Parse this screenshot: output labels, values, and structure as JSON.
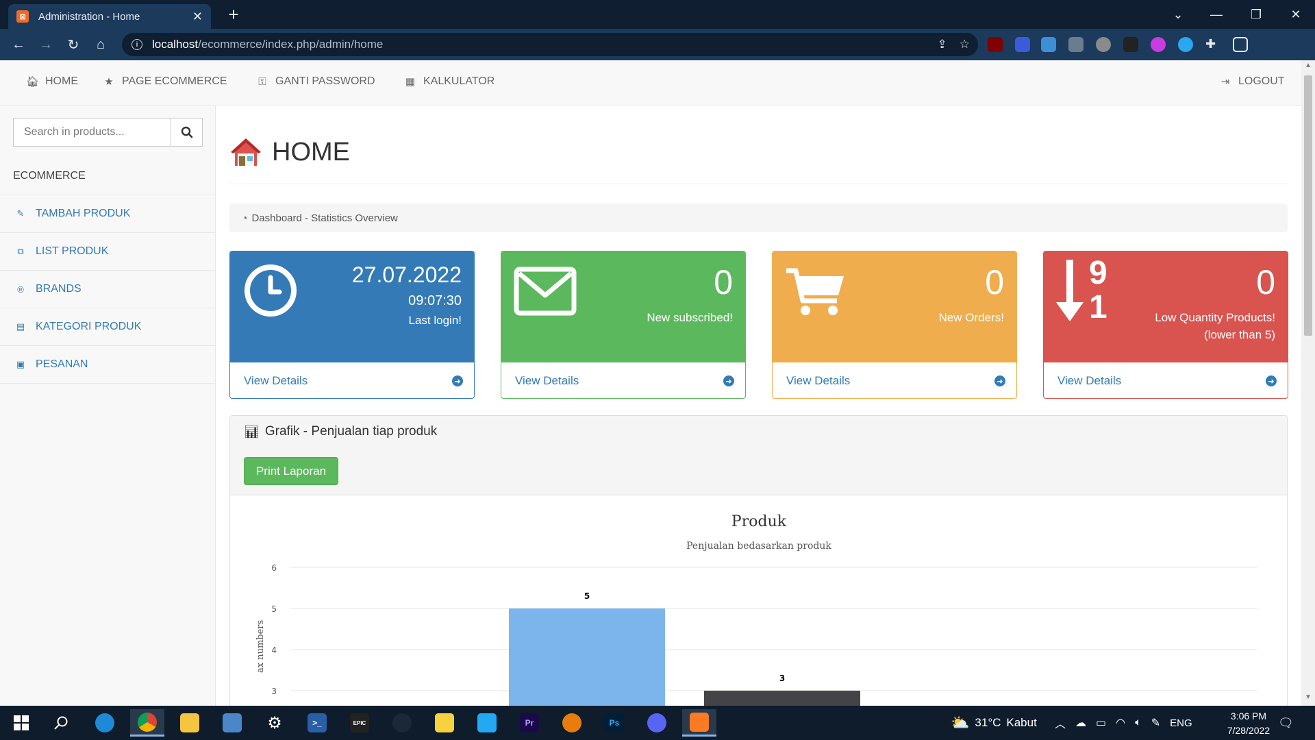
{
  "browser": {
    "tab_title": "Administration - Home",
    "tab_favicon_letter": "⊠",
    "url_host": "localhost",
    "url_path": "/ecommerce/index.php/admin/home"
  },
  "topnav": {
    "home": "HOME",
    "page_ecommerce": "PAGE ECOMMERCE",
    "ganti_password": "GANTI PASSWORD",
    "kalkulator": "KALKULATOR",
    "logout": "LOGOUT"
  },
  "sidebar": {
    "search_placeholder": "Search in products...",
    "heading": "ECOMMERCE",
    "items": [
      {
        "label": "TAMBAH PRODUK",
        "icon": "edit-icon"
      },
      {
        "label": "LIST PRODUK",
        "icon": "copy-icon"
      },
      {
        "label": "BRANDS",
        "icon": "registered-icon"
      },
      {
        "label": "KATEGORI PRODUK",
        "icon": "list-alt-icon"
      },
      {
        "label": "PESANAN",
        "icon": "money-icon"
      }
    ]
  },
  "main": {
    "title": "HOME",
    "breadcrumb": "Dashboard - Statistics Overview",
    "panels": [
      {
        "name": "last-login",
        "big": "27.07.2022",
        "sub1": "09:07:30",
        "sub2": "Last login!",
        "link": "View Details",
        "color": "#337ab7",
        "icon": "clock-icon"
      },
      {
        "name": "subscribed",
        "big": "0",
        "sub1": "New subscribed!",
        "link": "View Details",
        "color": "#5cb85c",
        "icon": "envelope-icon"
      },
      {
        "name": "orders",
        "big": "0",
        "sub1": "New Orders!",
        "link": "View Details",
        "color": "#f0ad4e",
        "icon": "cart-icon"
      },
      {
        "name": "low-quantity",
        "big": "0",
        "sub1": "Low Quantity Products!",
        "sub2": "(lower than 5)",
        "link": "View Details",
        "color": "#d9534f",
        "icon": "sort-numeric-desc-icon",
        "icon_digits": [
          "9",
          "1"
        ]
      }
    ],
    "chart_panel_title": "Grafik - Penjualan tiap produk",
    "print_button": "Print Laporan"
  },
  "chart_data": {
    "type": "bar",
    "title": "Produk",
    "subtitle": "Penjualan bedasarkan produk",
    "ylabel": "ax numbers",
    "ylim": [
      0,
      6
    ],
    "yticks": [
      "3",
      "4",
      "5",
      "6"
    ],
    "visible_bars": [
      {
        "value": 5,
        "label": "5",
        "color": "#7cb5ec"
      },
      {
        "value": 3,
        "label": "3",
        "color": "#434348"
      }
    ]
  },
  "taskbar": {
    "weather_temp": "31°C",
    "weather_text": "Kabut",
    "lang": "ENG",
    "time": "3:06 PM",
    "date": "7/28/2022"
  },
  "colors": {
    "link": "#337ab7",
    "primary": "#337ab7",
    "success": "#5cb85c",
    "warning": "#f0ad4e",
    "danger": "#d9534f"
  }
}
